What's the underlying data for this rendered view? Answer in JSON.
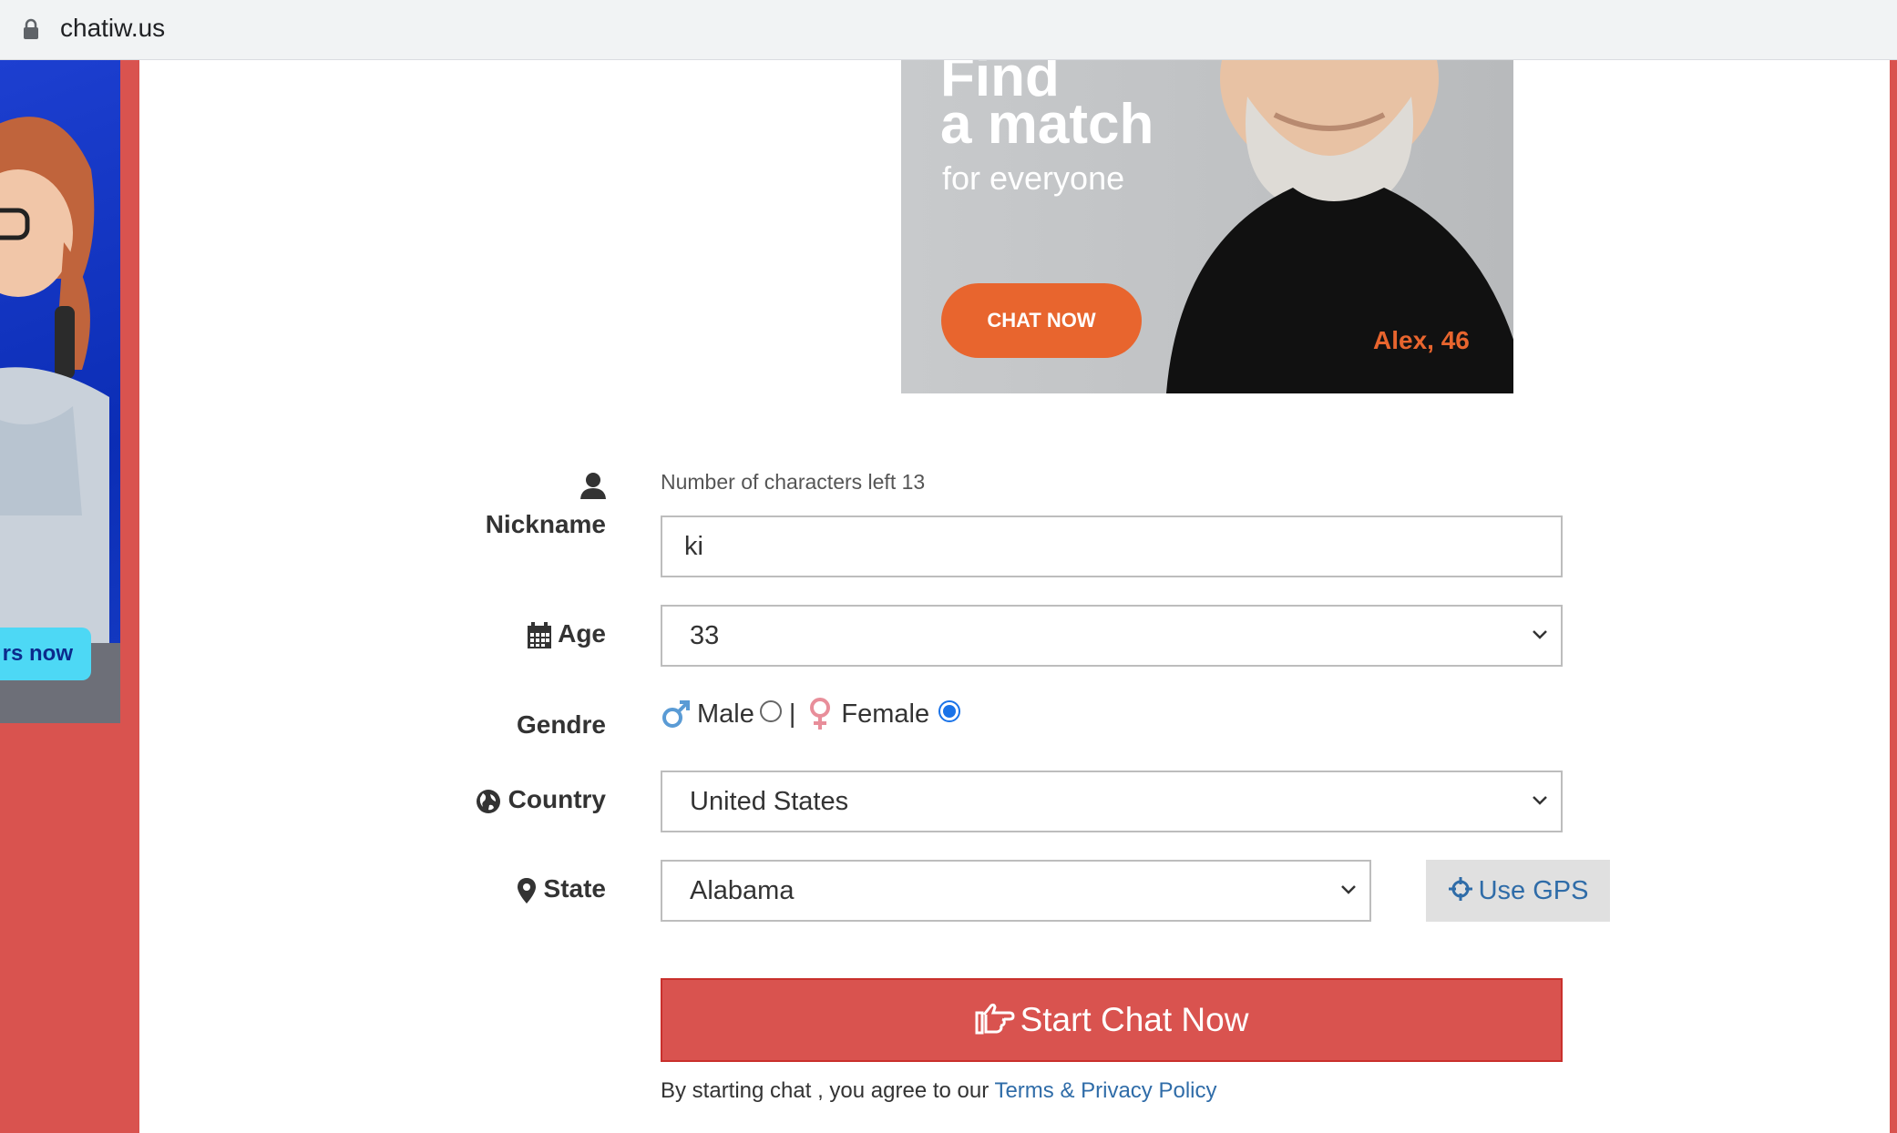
{
  "browser": {
    "url": "chatiw.us"
  },
  "side_ad": {
    "cta_label": "rs now"
  },
  "banner_ad": {
    "headline_1": "Find",
    "headline_2": "a match",
    "subline": "for everyone",
    "button_label": "CHAT NOW",
    "caption": "Alex, 46",
    "accent_color": "#e8652e"
  },
  "form": {
    "nickname": {
      "label": "Nickname",
      "hint": "Number of characters left 13",
      "value": "ki"
    },
    "age": {
      "label": "Age",
      "selected": "33"
    },
    "gender": {
      "label": "Gendre",
      "male_label": "Male",
      "separator": "|",
      "female_label": "Female",
      "selected": "Female"
    },
    "country": {
      "label": "Country",
      "selected": "United States"
    },
    "state": {
      "label": "State",
      "selected": "Alabama"
    },
    "gps_button": "Use GPS",
    "start_button": "Start Chat Now",
    "terms_prefix": "By starting chat , you agree to our",
    "terms_link": "Terms & Privacy Policy"
  },
  "colors": {
    "brand_red": "#d9534f",
    "link_blue": "#2f6ca8"
  }
}
